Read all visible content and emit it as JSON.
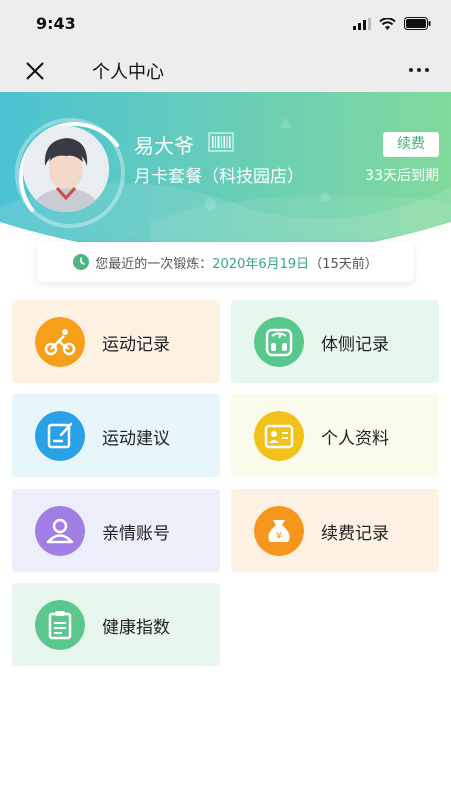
{
  "status_bar": {
    "time": "9:43"
  },
  "nav": {
    "title": "个人中心",
    "close_icon": "close-icon",
    "more_icon": "more-icon"
  },
  "profile": {
    "name": "易大爷",
    "plan": "月卡套餐（科技园店）",
    "renew_label": "续费",
    "expire_text": "33天后到期"
  },
  "last_exercise": {
    "prefix": "您最近的一次锻炼：",
    "date": "2020年6月19日",
    "suffix": "（15天前）"
  },
  "menu": [
    {
      "label": "运动记录",
      "icon": "cycling-icon",
      "bg": "#fdf1e4",
      "icon_color": "#f6a01a"
    },
    {
      "label": "体侧记录",
      "icon": "body-scale-icon",
      "bg": "#e6f7ee",
      "icon_color": "#57c78b"
    },
    {
      "label": "运动建议",
      "icon": "note-edit-icon",
      "bg": "#e6f6fa",
      "icon_color": "#2aa1e6"
    },
    {
      "label": "个人资料",
      "icon": "id-card-icon",
      "bg": "#fbfbec",
      "icon_color": "#f3c21a"
    },
    {
      "label": "亲情账号",
      "icon": "user-icon",
      "bg": "#eceefa",
      "icon_color": "#a07ee3"
    },
    {
      "label": "续费记录",
      "icon": "money-bag-icon",
      "bg": "#fdf1e4",
      "icon_color": "#f7961d"
    },
    {
      "label": "健康指数",
      "icon": "clipboard-icon",
      "bg": "#e8f7ee",
      "icon_color": "#5bc78c"
    }
  ],
  "colors": {
    "accent": "#3fb07d",
    "header_from": "#4fc3cf",
    "header_to": "#7dd79e"
  }
}
